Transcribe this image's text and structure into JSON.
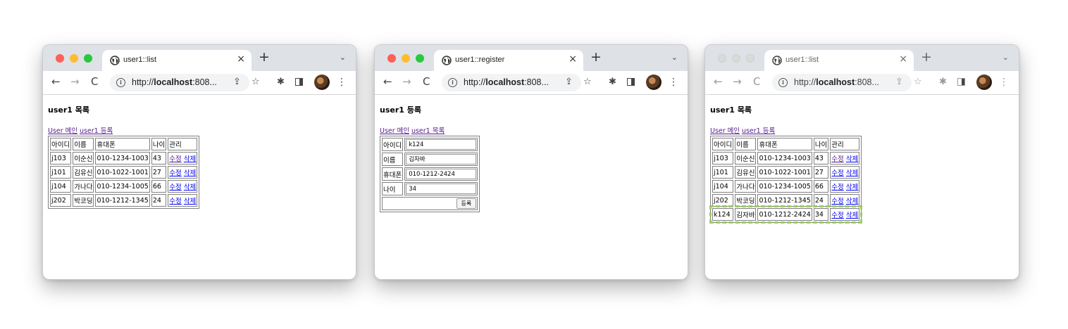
{
  "windows": [
    {
      "tab_title": "user1::list",
      "url_prefix": "http://",
      "url_host": "localhost",
      "url_rest": ":808...",
      "heading": "user1 목록",
      "links": [
        "User 메인",
        "user1 등록"
      ],
      "table": {
        "headers": [
          "아이디",
          "이름",
          "휴대폰",
          "나이",
          "관리"
        ],
        "rows": [
          [
            "j103",
            "이순신",
            "010-1234-1003",
            "43"
          ],
          [
            "j101",
            "김유신",
            "010-1022-1001",
            "27"
          ],
          [
            "j104",
            "가나다",
            "010-1234-1005",
            "66"
          ],
          [
            "j202",
            "박코딩",
            "010-1212-1345",
            "24"
          ]
        ],
        "actions": [
          "수정",
          "삭제"
        ]
      }
    },
    {
      "tab_title": "user1::register",
      "url_prefix": "http://",
      "url_host": "localhost",
      "url_rest": ":808...",
      "heading": "user1 등록",
      "links": [
        "User 메인",
        "user1 목록"
      ],
      "form": {
        "fields": [
          {
            "label": "아이디",
            "value": "k124"
          },
          {
            "label": "이름",
            "value": "김자바"
          },
          {
            "label": "휴대폰",
            "value": "010-1212-2424"
          },
          {
            "label": "나이",
            "value": "34"
          }
        ],
        "submit": "등록"
      }
    },
    {
      "tab_title": "user1::list",
      "url_prefix": "http://",
      "url_host": "localhost",
      "url_rest": ":808...",
      "heading": "user1 목록",
      "links": [
        "User 메인",
        "user1 등록"
      ],
      "table": {
        "headers": [
          "아이디",
          "이름",
          "휴대폰",
          "나이",
          "관리"
        ],
        "rows": [
          [
            "j103",
            "이순신",
            "010-1234-1003",
            "43"
          ],
          [
            "j101",
            "김유신",
            "010-1022-1001",
            "27"
          ],
          [
            "j104",
            "가나다",
            "010-1234-1005",
            "66"
          ],
          [
            "j202",
            "박코딩",
            "010-1212-1345",
            "24"
          ],
          [
            "k124",
            "김자바",
            "010-1212-2424",
            "34"
          ]
        ],
        "actions": [
          "수정",
          "삭제"
        ]
      }
    }
  ],
  "icons": {
    "tab_favicon": "globe-icon",
    "close": "×",
    "new_tab": "+",
    "tab_menu": "⌄",
    "back": "←",
    "forward": "→",
    "reload": "C",
    "info": "i",
    "share": "⇪",
    "bookmark": "☆",
    "extensions": "✱",
    "more": "⋮"
  },
  "colors": {
    "highlight": "#9ccc65",
    "link_visited": "#551a8b",
    "link": "#0000ee"
  }
}
